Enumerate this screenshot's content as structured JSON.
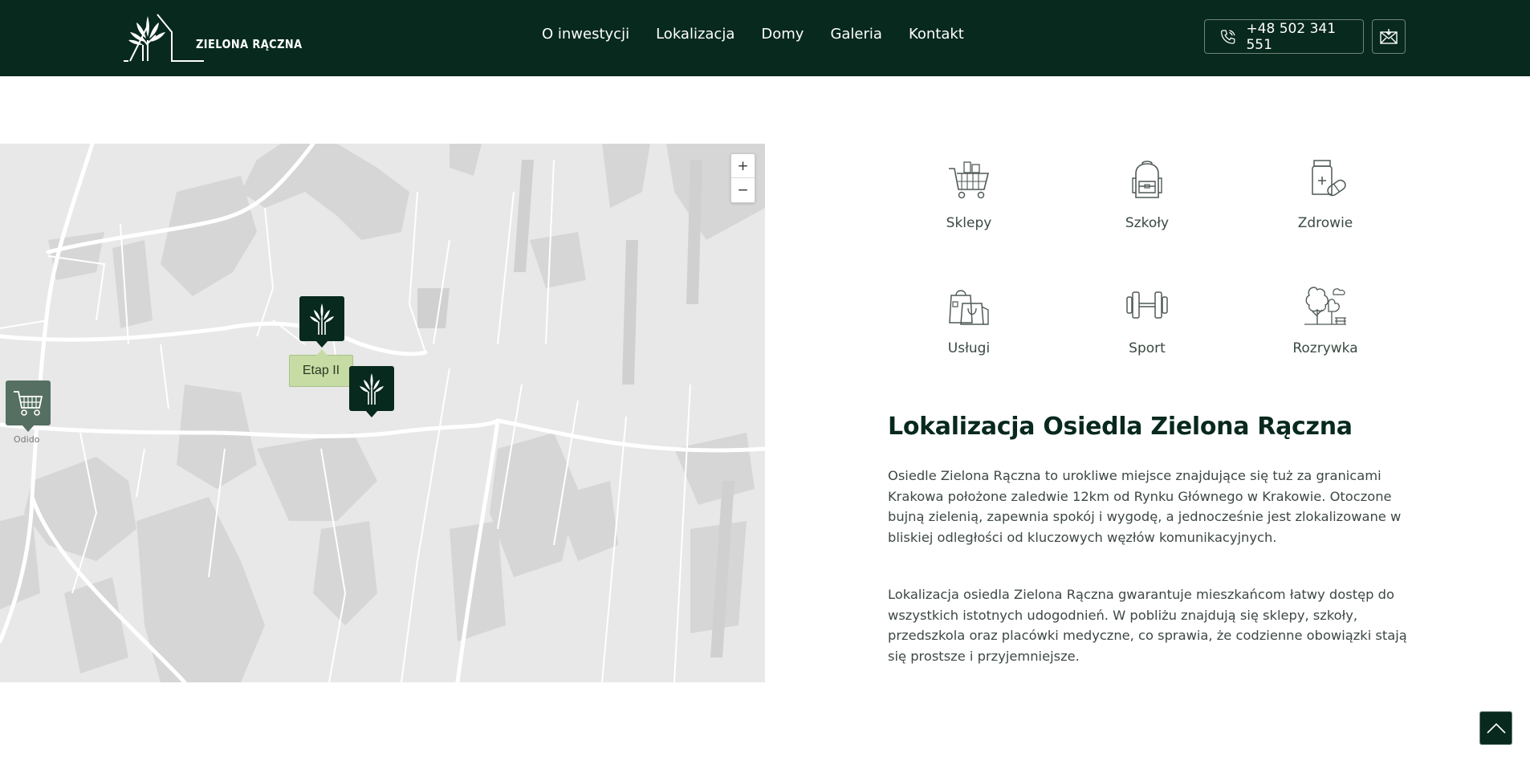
{
  "header": {
    "logo_text": "ZIELONA RĄCZNA",
    "nav": [
      "O inwestycji",
      "Lokalizacja",
      "Domy",
      "Galeria",
      "Kontakt"
    ],
    "phone": "+48 502 341 551"
  },
  "map": {
    "zoom_in": "+",
    "zoom_out": "−",
    "tooltip": "Etap II",
    "shop_label": "Odido"
  },
  "amenities": [
    {
      "label": "Sklepy",
      "icon": "shopping-cart-icon"
    },
    {
      "label": "Szkoły",
      "icon": "backpack-icon"
    },
    {
      "label": "Zdrowie",
      "icon": "medicine-icon"
    },
    {
      "label": "Usługi",
      "icon": "shopping-bags-icon"
    },
    {
      "label": "Sport",
      "icon": "dumbbell-icon"
    },
    {
      "label": "Rozrywka",
      "icon": "park-icon"
    }
  ],
  "section": {
    "title": "Lokalizacja Osiedla Zielona Rączna",
    "p1": "Osiedle Zielona Rączna to urokliwe miejsce znajdujące się tuż za granicami Krakowa położone zaledwie 12km od Rynku Głównego w Krakowie. Otoczone bujną zielenią, zapewnia spokój i wygodę, a jednocześnie jest zlokalizowane w bliskiej odległości od kluczowych węzłów komunikacyjnych.",
    "p2": "Lokalizacja osiedla Zielona Rączna gwarantuje mieszkańcom łatwy dostęp do wszystkich istotnych udogodnień. W pobliżu znajdują się sklepy, szkoły, przedszkola oraz placówki medyczne, co sprawia, że codzienne obowiązki stają się prostsze i przyjemniejsze."
  },
  "colors": {
    "brand_dark": "#08291d",
    "tooltip_green": "#c6dca4",
    "map_bg": "#e7e7e7"
  }
}
